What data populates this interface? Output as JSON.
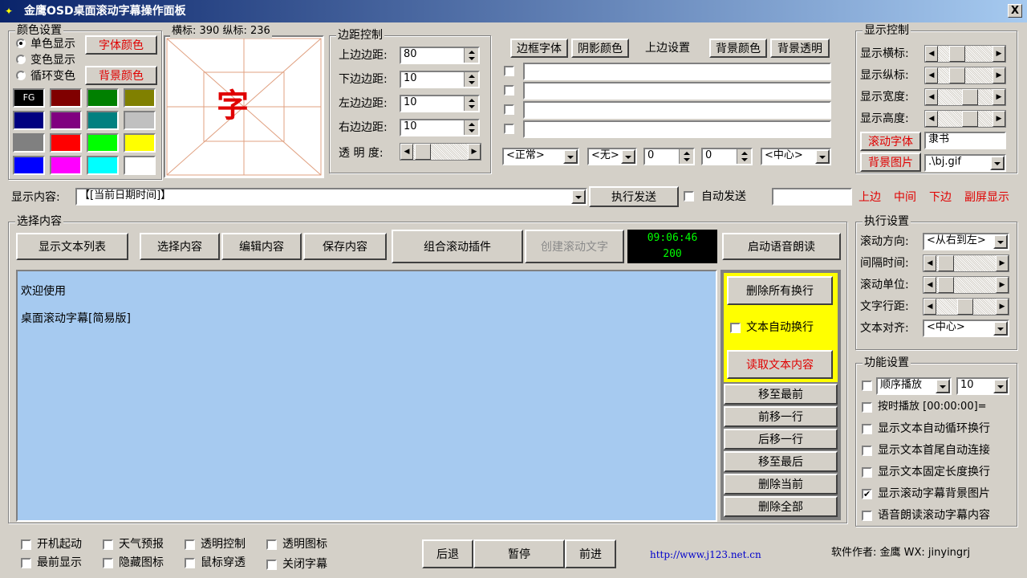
{
  "window": {
    "title": "金鹰OSD桌面滚动字幕操作面板",
    "close": "X"
  },
  "color_group": {
    "title": "颜色设置",
    "radio_single": "单色显示",
    "radio_change": "变色显示",
    "radio_cycle": "循环变色",
    "font_color_btn": "字体颜色",
    "bg_color_btn": "背景颜色",
    "swatches": [
      "#000000",
      "#800000",
      "#008000",
      "#808000",
      "#000080",
      "#800080",
      "#008080",
      "#c0c0c0",
      "#808080",
      "#ff0000",
      "#00ff00",
      "#ffff00",
      "#0000ff",
      "#ff00ff",
      "#00ffff",
      "#ffffff"
    ],
    "fg_label": "FG"
  },
  "preview": {
    "coords": "横标: 390 纵标: 236",
    "char": "字"
  },
  "margin_group": {
    "title": "边距控制",
    "top_label": "上边边距:",
    "top_value": "80",
    "bottom_label": "下边边距:",
    "bottom_value": "10",
    "left_label": "左边边距:",
    "left_value": "10",
    "right_label": "右边边距:",
    "right_value": "10",
    "opacity_label": "透 明 度:"
  },
  "effects": {
    "border_font": "边框字体",
    "shadow_color": "阴影颜色",
    "top_setting": "上边设置",
    "bg_color": "背景颜色",
    "bg_transparent": "背景透明",
    "combo1": "<正常>",
    "combo2": "<无>",
    "num1": "0",
    "num2": "0",
    "combo3": "<中心>"
  },
  "display_control": {
    "title": "显示控制",
    "h_label": "显示横标:",
    "v_label": "显示纵标:",
    "w_label": "显示宽度:",
    "ht_label": "显示高度:",
    "scroll_font_btn": "滚动字体",
    "font_value": "隶书",
    "bg_image_btn": "背景图片",
    "bg_image_value": ".\\bj.gif"
  },
  "content_row": {
    "label": "显示内容:",
    "value": "【[当前日期时间]】",
    "send_btn": "执行发送",
    "auto_send": "自动发送",
    "pos_top": "上边",
    "pos_mid": "中间",
    "pos_bottom": "下边",
    "pos_sub": "副屏显示"
  },
  "select_group": {
    "title": "选择内容",
    "btn_list": "显示文本列表",
    "btn_select": "选择内容",
    "btn_edit": "编辑内容",
    "btn_save": "保存内容",
    "btn_plugin": "组合滚动插件",
    "btn_create": "创建滚动文字",
    "clock_time": "09:06:46",
    "clock_num": "200",
    "btn_voice": "启动语音朗读"
  },
  "text_area": {
    "line1": "欢迎使用",
    "line2": "桌面滚动字幕[简易版]"
  },
  "side_panel": {
    "del_newlines": "删除所有换行",
    "auto_wrap": "文本自动换行",
    "read_text": "读取文本内容",
    "move_top": "移至最前",
    "move_up": "前移一行",
    "move_down": "后移一行",
    "move_bottom": "移至最后",
    "del_current": "删除当前",
    "del_all": "删除全部"
  },
  "exec_group": {
    "title": "执行设置",
    "dir_label": "滚动方向:",
    "dir_value": "<从右到左>",
    "interval_label": "间隔时间:",
    "unit_label": "滚动单位:",
    "spacing_label": "文字行距:",
    "align_label": "文本对齐:",
    "align_value": "<中心>"
  },
  "func_group": {
    "title": "功能设置",
    "order_play": "顺序播放",
    "order_num": "10",
    "timed_play": "按时播放 [00:00:00]=",
    "opt1": "显示文本自动循环换行",
    "opt2": "显示文本首尾自动连接",
    "opt3": "显示文本固定长度换行",
    "opt4": "显示滚动字幕背景图片",
    "opt5": "语音朗读滚动字幕内容"
  },
  "bottom": {
    "boot": "开机起动",
    "weather": "天气预报",
    "transparent_ctrl": "透明控制",
    "transparent_icon": "透明图标",
    "topmost": "最前显示",
    "hide_icon": "隐藏图标",
    "mouse_through": "鼠标穿透",
    "close_subtitle": "关闭字幕",
    "back": "后退",
    "pause": "暂停",
    "forward": "前进",
    "url": "http://www.j123.net.cn",
    "author": "软件作者: 金鹰 WX: jinyingrj"
  },
  "colors": {
    "accent_red": "#e00000",
    "text_area_bg": "#a6caf0",
    "highlight_yellow": "#ffff00"
  }
}
